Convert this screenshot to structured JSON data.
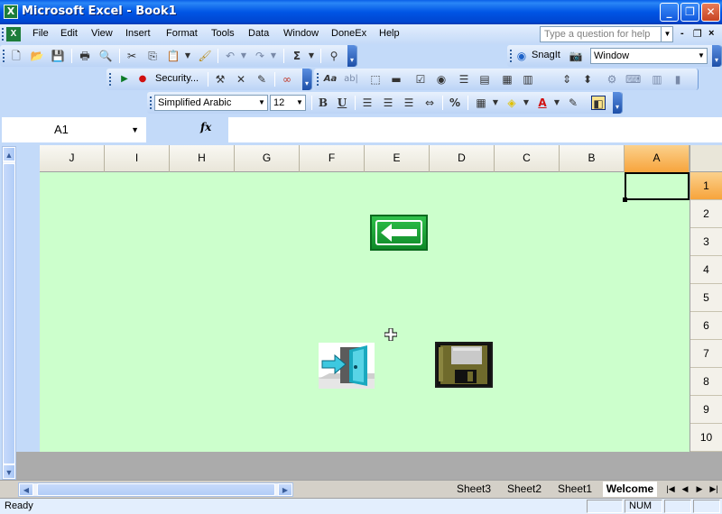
{
  "window": {
    "title": "Microsoft Excel - Book1",
    "app_icon": "excel-icon",
    "controls": {
      "minimize": "_",
      "maximize": "❐",
      "close": "✕"
    }
  },
  "menu": {
    "items": [
      "File",
      "Edit",
      "View",
      "Insert",
      "Format",
      "Tools",
      "Data",
      "Window",
      "DoneEx",
      "Help"
    ],
    "help_placeholder": "Type a question for help",
    "mdi_min": "-",
    "mdi_restore": "❐",
    "mdi_close": "×"
  },
  "toolbar1": {
    "sum_glyph": "Σ",
    "snagit_label": "SnagIt",
    "window_combo_value": "Window"
  },
  "toolbar2": {
    "security_label": "Security...",
    "text_glyph": "Aa",
    "text_glyph2": "ab|"
  },
  "formatting": {
    "font_name": "Simplified Arabic",
    "font_size": "12",
    "bold": "B",
    "underline": "U",
    "percent": "%",
    "font_color_glyph": "A"
  },
  "formula_bar": {
    "name_box": "A1",
    "fx_label": "fx",
    "formula_value": ""
  },
  "grid": {
    "columns": [
      "J",
      "I",
      "H",
      "G",
      "F",
      "E",
      "D",
      "C",
      "B",
      "A"
    ],
    "rows": [
      "1",
      "2",
      "3",
      "4",
      "5",
      "6",
      "7",
      "8",
      "9",
      "10"
    ],
    "active_column": "A",
    "active_row": "1",
    "background_color": "#ccffcc"
  },
  "buttons": {
    "back": "back-arrow-icon",
    "exit": "exit-door-icon",
    "save": "floppy-disk-icon"
  },
  "sheets": {
    "tabs": [
      "Sheet3",
      "Sheet2",
      "Sheet1",
      "Welcome"
    ],
    "active": "Welcome"
  },
  "status": {
    "ready": "Ready",
    "num": "NUM"
  }
}
